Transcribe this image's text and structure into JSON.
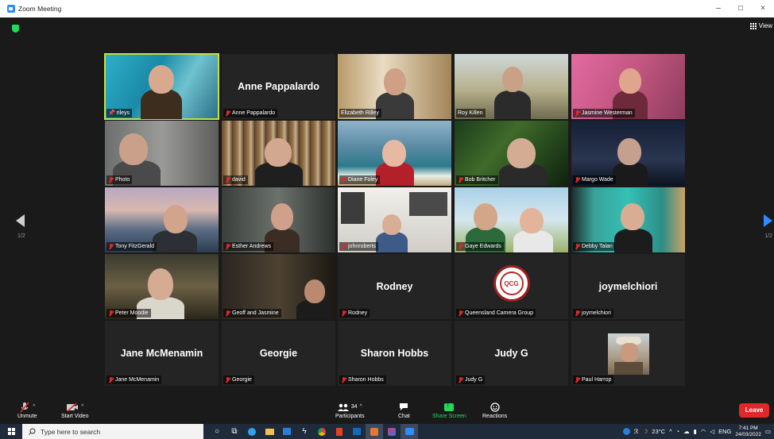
{
  "window": {
    "title": "Zoom Meeting",
    "controls": [
      "–",
      "□",
      "×"
    ]
  },
  "view_button": {
    "label": "View"
  },
  "pagination": {
    "left": "1/2",
    "right": "1/2"
  },
  "participants": [
    {
      "name": "rileys",
      "video": true,
      "active": true,
      "pinned": true
    },
    {
      "name": "Anne Pappalardo",
      "video": false,
      "center_name": "Anne Pappalardo"
    },
    {
      "name": "Elizabeth Rilley",
      "video": true,
      "mic": "on"
    },
    {
      "name": "Roy Killen",
      "video": true,
      "mic": "on"
    },
    {
      "name": "Jasmine Westerman",
      "video": true
    },
    {
      "name": "Photo",
      "video": true
    },
    {
      "name": "david",
      "video": true
    },
    {
      "name": "Diane Foley",
      "video": true
    },
    {
      "name": "Bob Britcher",
      "video": true
    },
    {
      "name": "Margo Wade",
      "video": true
    },
    {
      "name": "Tony FitzGerald",
      "video": true
    },
    {
      "name": "Esther Andrews",
      "video": true
    },
    {
      "name": "johnroberts",
      "video": true
    },
    {
      "name": "Gaye Edwards",
      "video": true
    },
    {
      "name": "Debby Talan",
      "video": true
    },
    {
      "name": "Peter Moodie",
      "video": true
    },
    {
      "name": "Geoff and Jasmine",
      "video": true
    },
    {
      "name": "Rodney",
      "video": false,
      "center_name": "Rodney"
    },
    {
      "name": "Queensland Camera Group",
      "video": false,
      "logo_text": "QCG"
    },
    {
      "name": "joymelchiori",
      "video": false,
      "center_name": "joymelchiori"
    },
    {
      "name": "Jane McMenamin",
      "video": false,
      "center_name": "Jane McMenamin"
    },
    {
      "name": "Georgie",
      "video": false,
      "center_name": "Georgie"
    },
    {
      "name": "Sharon Hobbs",
      "video": false,
      "center_name": "Sharon Hobbs"
    },
    {
      "name": "Judy G",
      "video": false,
      "center_name": "Judy G"
    },
    {
      "name": "Paul Harrop",
      "video": false,
      "avatar": true
    }
  ],
  "toolbar": {
    "unmute": "Unmute",
    "start_video": "Start Video",
    "participants": "Participants",
    "participant_count": "34",
    "chat": "Chat",
    "share_screen": "Share Screen",
    "reactions": "Reactions",
    "leave": "Leave"
  },
  "taskbar": {
    "search_placeholder": "Type here to search",
    "temperature": "23°C",
    "language": "ENG",
    "time": "7:41 PM",
    "date": "24/03/2022"
  },
  "colors": {
    "active_speaker": "#c6e03c",
    "leave": "#e02828",
    "share": "#23d959",
    "muted": "#e02828"
  }
}
